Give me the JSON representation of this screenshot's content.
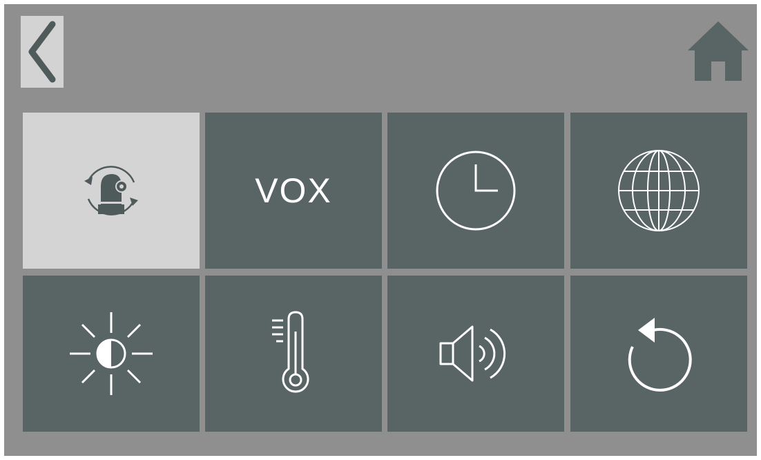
{
  "nav": {
    "back_icon": "chevron-left-icon",
    "home_icon": "home-icon"
  },
  "tiles": [
    {
      "id": "camera-rotate",
      "icon": "camera-rotate-icon",
      "selected": true
    },
    {
      "id": "vox",
      "label": "VOX",
      "selected": false
    },
    {
      "id": "clock",
      "icon": "clock-icon",
      "selected": false
    },
    {
      "id": "language",
      "icon": "globe-icon",
      "selected": false
    },
    {
      "id": "brightness",
      "icon": "brightness-icon",
      "selected": false
    },
    {
      "id": "temperature",
      "icon": "thermometer-icon",
      "selected": false
    },
    {
      "id": "volume",
      "icon": "speaker-icon",
      "selected": false
    },
    {
      "id": "reset",
      "icon": "reset-icon",
      "selected": false
    }
  ],
  "colors": {
    "background": "#8f8f8f",
    "tile": "#596464",
    "tile_selected": "#d4d4d4",
    "icon_light": "#ffffff",
    "icon_dark": "#4f5a5a"
  }
}
